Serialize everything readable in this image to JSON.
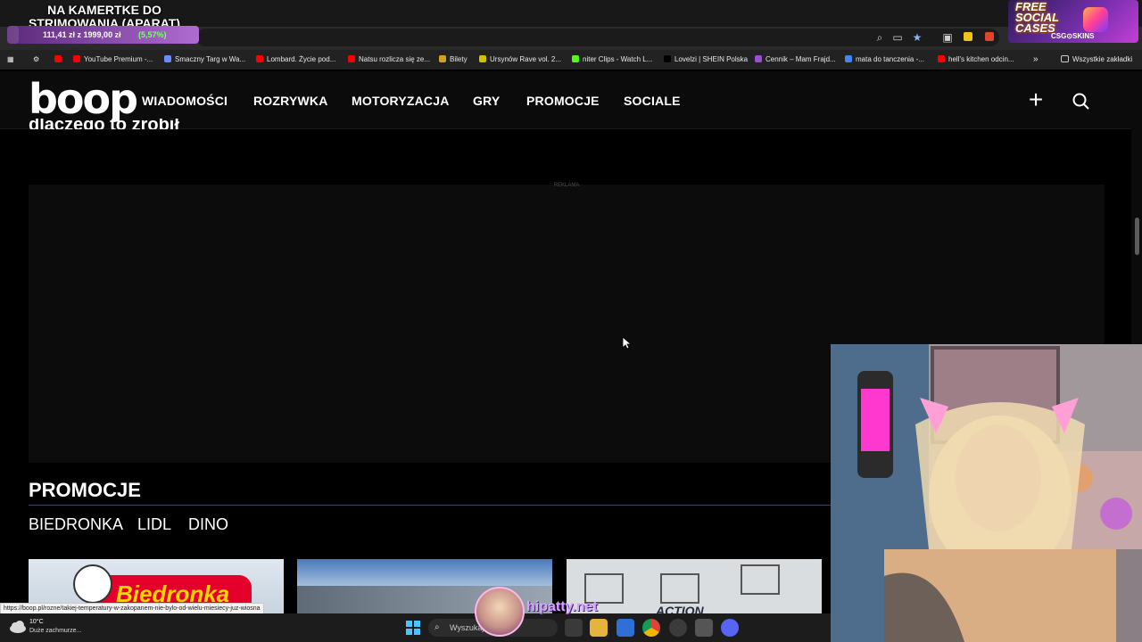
{
  "overlay": {
    "stream_title": "NA KAMERTKE DO STRIMOWANIA (APARAT)",
    "donation_goal": {
      "text": "111,41 zł z 1999,00 zł",
      "percent": "(5,57%)",
      "progress": 0.0557
    },
    "promo_badge": {
      "text": "FREE SOCIAL CASES",
      "brand": "CSG⊙SKINS"
    },
    "watermark": "hipatty.net"
  },
  "browser": {
    "bookmarks": [
      {
        "label": "YouTube Premium -...",
        "color": "#ff0000"
      },
      {
        "label": "Smaczny Targ w Wa...",
        "color": "#6b8cff"
      },
      {
        "label": "Lombard. Życie pod...",
        "color": "#ff0000"
      },
      {
        "label": "Natsu rozlicza się ze...",
        "color": "#ff0000"
      },
      {
        "label": "Bilety",
        "color": "#d4a017"
      },
      {
        "label": "Ursynów Rave vol. 2...",
        "color": "#d4c000"
      },
      {
        "label": "niter Clips - Watch L...",
        "color": "#53fc18"
      },
      {
        "label": "Lovelzi | SHEIN Polska",
        "color": "#000000"
      },
      {
        "label": "Cennik – Mam Frajd...",
        "color": "#a04bd6"
      },
      {
        "label": "mata do tanczenia -...",
        "color": "#4285f4"
      },
      {
        "label": "hell's kitchen odcin...",
        "color": "#ff0000"
      }
    ],
    "more_bookmarks": "»",
    "all_bookmarks": "Wszystkie zakładki",
    "status_url": "https://boop.pl/rozne/takiej-temperatury-w-zakopanem-nie-bylo-od-wielu-miesiecy-juz-wiosna"
  },
  "site": {
    "logo": "boop",
    "nav": [
      "WIADOMOŚCI",
      "ROZRYWKA",
      "MOTORYZACJA",
      "GRY",
      "PROMOCJE",
      "SOCIALE"
    ],
    "plus_label": "+",
    "cut_heading": "dlaczego to zrobił",
    "ad_label": "REKLAMA",
    "section_title": "PROMOCJE",
    "categories": [
      "BIEDRONKA",
      "LIDL",
      "DINO"
    ],
    "cards": [
      {
        "label": "Biedronka"
      },
      {
        "label": ""
      },
      {
        "label": "ACTION"
      }
    ]
  },
  "taskbar": {
    "weather_temp": "10°C",
    "weather_desc": "Duże zachmurze...",
    "search_placeholder": "Wyszukaj"
  }
}
